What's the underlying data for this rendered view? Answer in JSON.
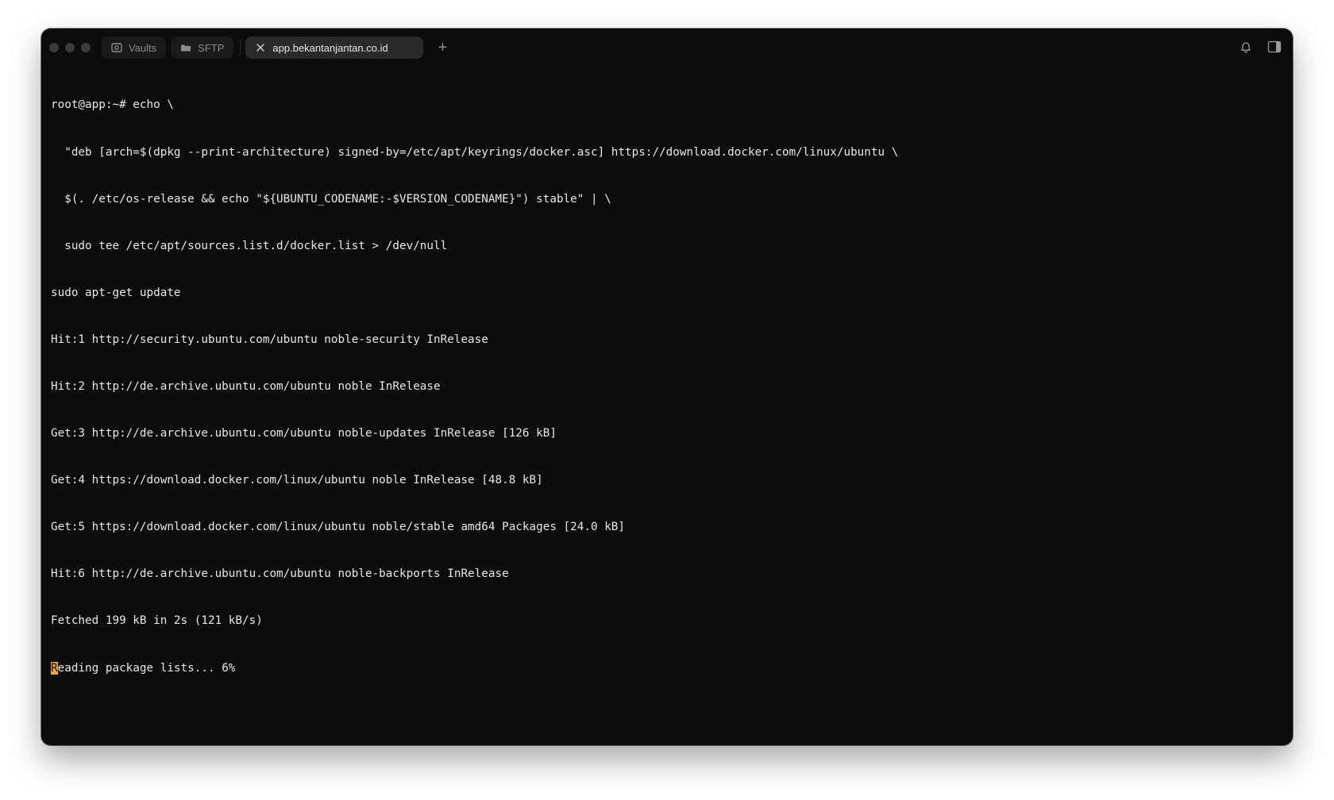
{
  "tabs": [
    {
      "label": "Vaults",
      "icon": "vault-icon"
    },
    {
      "label": "SFTP",
      "icon": "folder-icon"
    },
    {
      "label": "app.bekantanjantan.co.id",
      "icon": "close-icon",
      "active": true
    }
  ],
  "new_tab_label": "+",
  "toolbar_icons": [
    "bell-icon",
    "sidebar-toggle-icon"
  ],
  "colors": {
    "terminal_bg": "#0c0c0c",
    "text": "#e8e8e8",
    "cursor": "#f0a33c"
  },
  "terminal": {
    "lines": [
      "root@app:~# echo \\",
      "  \"deb [arch=$(dpkg --print-architecture) signed-by=/etc/apt/keyrings/docker.asc] https://download.docker.com/linux/ubuntu \\",
      "  $(. /etc/os-release && echo \"${UBUNTU_CODENAME:-$VERSION_CODENAME}\") stable\" | \\",
      "  sudo tee /etc/apt/sources.list.d/docker.list > /dev/null",
      "sudo apt-get update",
      "Hit:1 http://security.ubuntu.com/ubuntu noble-security InRelease",
      "Hit:2 http://de.archive.ubuntu.com/ubuntu noble InRelease",
      "Get:3 http://de.archive.ubuntu.com/ubuntu noble-updates InRelease [126 kB]",
      "Get:4 https://download.docker.com/linux/ubuntu noble InRelease [48.8 kB]",
      "Get:5 https://download.docker.com/linux/ubuntu noble/stable amd64 Packages [24.0 kB]",
      "Hit:6 http://de.archive.ubuntu.com/ubuntu noble-backports InRelease",
      "Fetched 199 kB in 2s (121 kB/s)"
    ],
    "cursor_char": "R",
    "last_line_rest": "eading package lists... 6%"
  }
}
